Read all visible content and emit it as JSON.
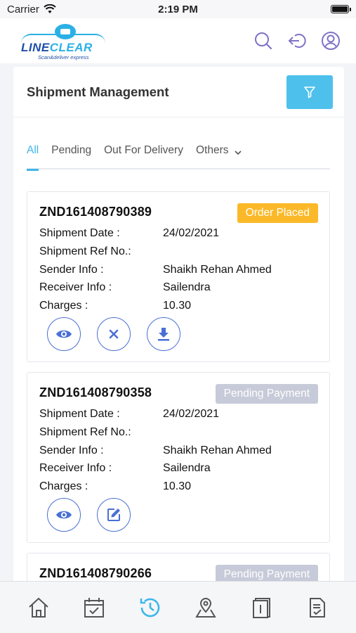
{
  "status_bar": {
    "carrier": "Carrier",
    "time": "2:19 PM"
  },
  "brand": {
    "name_line": "LINE",
    "name_clear": "CLEAR",
    "tagline": "Scan&deliver express"
  },
  "header_icons": [
    "search-icon",
    "logout-icon",
    "user-icon"
  ],
  "page": {
    "title": "Shipment Management"
  },
  "tabs": [
    {
      "label": "All",
      "active": true
    },
    {
      "label": "Pending",
      "active": false
    },
    {
      "label": "Out For Delivery",
      "active": false
    },
    {
      "label": "Others",
      "active": false
    }
  ],
  "field_labels": {
    "date": "Shipment Date :",
    "ref": "Shipment Ref No.:",
    "sender": "Sender Info :",
    "receiver": "Receiver Info :",
    "charges": "Charges :"
  },
  "shipments": [
    {
      "id": "ZND161408790389",
      "status": "Order Placed",
      "date": "24/02/2021",
      "ref": "",
      "sender": "Shaikh Rehan Ahmed",
      "receiver": "Sailendra",
      "charges": "10.30",
      "actions": [
        "view",
        "cancel",
        "download"
      ]
    },
    {
      "id": "ZND161408790358",
      "status": "Pending Payment",
      "date": "24/02/2021",
      "ref": "",
      "sender": "Shaikh Rehan Ahmed",
      "receiver": "Sailendra",
      "charges": "10.30",
      "actions": [
        "view",
        "edit"
      ]
    },
    {
      "id": "ZND161408790266",
      "status": "Pending Payment"
    }
  ],
  "bottom_nav": [
    "home-icon",
    "calendar-icon",
    "history-icon",
    "location-icon",
    "docs-icon",
    "checklist-icon"
  ],
  "colors": {
    "accent": "#3fb6ea",
    "order_placed": "#fbb929",
    "pending": "#c7cad8",
    "action_blue": "#4a6fd6"
  }
}
